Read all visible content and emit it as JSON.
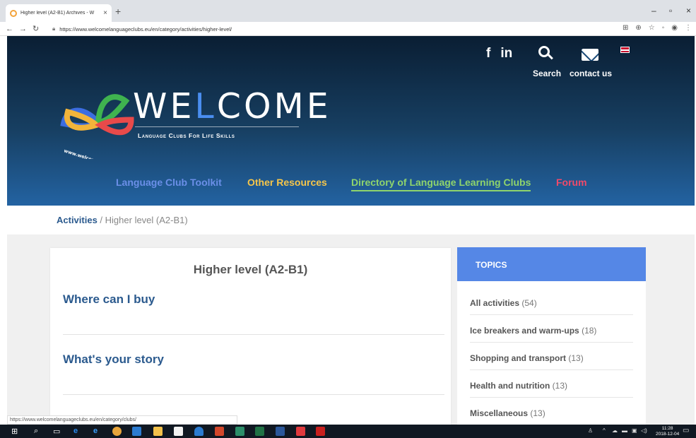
{
  "browser": {
    "tab_title": "Higher level (A2-B1) Archives - W",
    "tab_close": "×",
    "new_tab": "+",
    "url": "https://www.welcomelanguageclubs.eu/en/category/activities/higher-level/",
    "window_controls": [
      "–",
      "▫",
      "×"
    ]
  },
  "header": {
    "social": [
      "f",
      "in"
    ],
    "search_label": "Search",
    "contact_label": "contact us",
    "logo_word": "WE",
    "logo_l": "L",
    "logo_rest": "COME",
    "tagline": "Language Clubs For Life Skills",
    "logo_ring_text": "www.welcomelanguageclubs.eu",
    "nav": [
      {
        "label": "Language Club Toolkit",
        "color": "#6b8fe8"
      },
      {
        "label": "Other Resources",
        "color": "#f6c64a"
      },
      {
        "label": "Directory of Language Learning Clubs",
        "color": "#8fd46c"
      },
      {
        "label": "Forum",
        "color": "#f04a6a"
      }
    ]
  },
  "breadcrumb": {
    "link": "Activities",
    "separator": " / ",
    "current": "Higher level (A2-B1)"
  },
  "main": {
    "title": "Higher level (A2-B1)",
    "posts": [
      "Where can I buy",
      "What's your story"
    ]
  },
  "sidebar": {
    "heading": "TOPICS",
    "topics": [
      {
        "label": "All activities",
        "count": "(54)"
      },
      {
        "label": "Ice breakers and warm-ups",
        "count": "(18)"
      },
      {
        "label": "Shopping and transport",
        "count": "(13)"
      },
      {
        "label": "Health and nutrition",
        "count": "(13)"
      },
      {
        "label": "Miscellaneous",
        "count": "(13)"
      }
    ]
  },
  "status_url": "https://www.welcomelanguageclubs.eu/en/category/clubs/",
  "taskbar": {
    "time": "11:28",
    "date": "2018-12-04"
  }
}
